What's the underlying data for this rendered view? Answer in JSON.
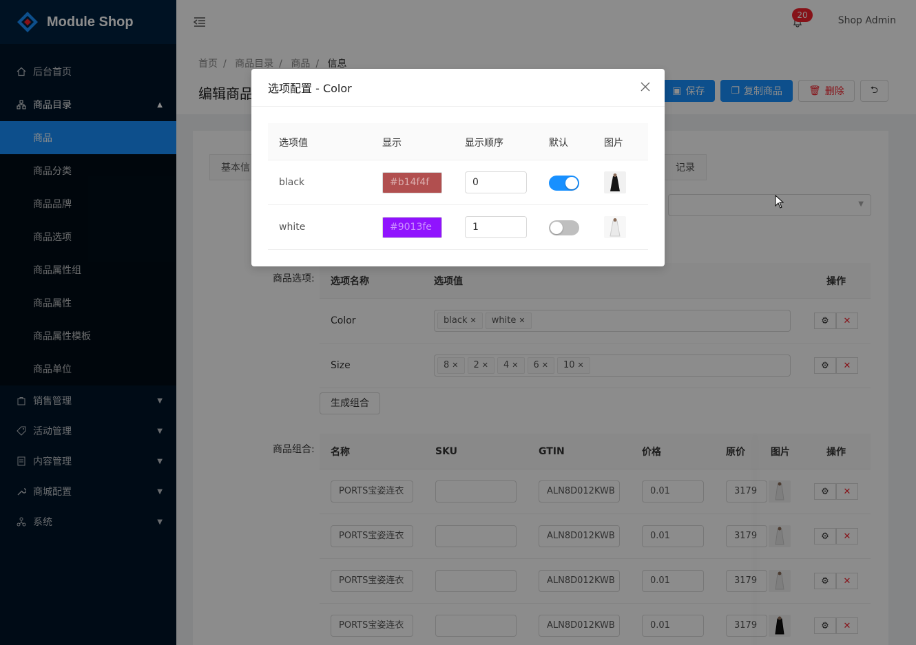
{
  "app": {
    "title": "Module Shop",
    "user": "Shop Admin",
    "notification_count": "20"
  },
  "sidebar": {
    "items": [
      {
        "label": "后台首页",
        "icon": "home-icon"
      },
      {
        "label": "商品目录",
        "icon": "cluster-icon"
      },
      {
        "label": "销售管理",
        "icon": "shopping-bag-icon"
      },
      {
        "label": "活动管理",
        "icon": "tag-icon"
      },
      {
        "label": "内容管理",
        "icon": "file-icon"
      },
      {
        "label": "商城配置",
        "icon": "wrench-icon"
      },
      {
        "label": "系统",
        "icon": "apartment-icon"
      }
    ],
    "catalog_children": [
      "商品",
      "商品分类",
      "商品品牌",
      "商品选项",
      "商品属性组",
      "商品属性",
      "商品属性模板",
      "商品单位"
    ],
    "active_child": "商品"
  },
  "breadcrumb": [
    "首页",
    "商品目录",
    "商品",
    "信息"
  ],
  "page": {
    "title": "编辑商品"
  },
  "actions": {
    "save": "保存",
    "copy": "复制商品",
    "delete": "删除"
  },
  "tabs": {
    "first": "基本信",
    "last": "记录"
  },
  "form": {
    "options_label": "商品选项:",
    "combos_label": "商品组合:",
    "generate_button": "生成组合"
  },
  "options_table": {
    "headers": [
      "选项名称",
      "选项值",
      "操作"
    ],
    "rows": [
      {
        "name": "Color",
        "values": [
          "black",
          "white"
        ]
      },
      {
        "name": "Size",
        "values": [
          "8",
          "2",
          "4",
          "6",
          "10"
        ]
      }
    ]
  },
  "combos_table": {
    "headers": [
      "名称",
      "SKU",
      "GTIN",
      "价格",
      "原价",
      "图片",
      "操作"
    ],
    "rows": [
      {
        "name": "PORTS宝姿连衣",
        "sku": "",
        "gtin": "ALN8D012KWB",
        "price": "0.01",
        "orig": "3179",
        "img": "white"
      },
      {
        "name": "PORTS宝姿连衣",
        "sku": "",
        "gtin": "ALN8D012KWB",
        "price": "0.01",
        "orig": "3179",
        "img": "white"
      },
      {
        "name": "PORTS宝姿连衣",
        "sku": "",
        "gtin": "ALN8D012KWB",
        "price": "0.01",
        "orig": "3179",
        "img": "white"
      },
      {
        "name": "PORTS宝姿连衣",
        "sku": "",
        "gtin": "ALN8D012KWB",
        "price": "0.01",
        "orig": "3179",
        "img": "black"
      }
    ]
  },
  "modal": {
    "title": "选项配置 - Color",
    "headers": [
      "选项值",
      "显示",
      "显示顺序",
      "默认",
      "图片"
    ],
    "rows": [
      {
        "value": "black",
        "display": "#b14f4f",
        "order": "0",
        "default": true,
        "img": "black"
      },
      {
        "value": "white",
        "display": "#9013fe",
        "order": "1",
        "default": false,
        "img": "white"
      }
    ]
  },
  "colors": {
    "sidebar_bg": "#001529",
    "primary": "#1890ff",
    "danger": "#f5222d",
    "swatch_black": "#b14f4f",
    "swatch_white": "#9013fe"
  }
}
